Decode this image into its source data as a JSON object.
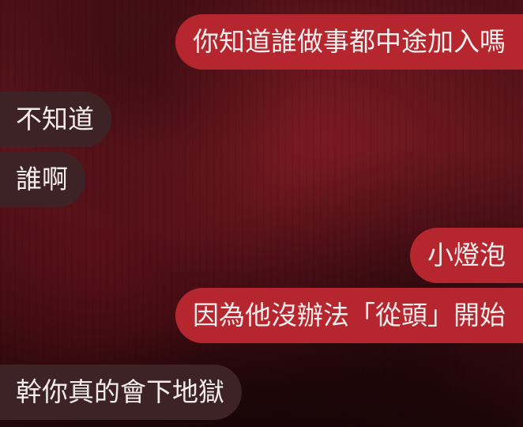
{
  "messages": [
    {
      "sender": "me",
      "text": "你知道誰做事都中途加入嗎"
    },
    {
      "sender": "other",
      "text": "不知道"
    },
    {
      "sender": "other",
      "text": "誰啊"
    },
    {
      "sender": "me",
      "text": "小燈泡"
    },
    {
      "sender": "me",
      "text": "因為他沒辦法「從頭」開始"
    },
    {
      "sender": "other",
      "text": "幹你真的會下地獄"
    }
  ],
  "colors": {
    "sent_bubble": "#b6262e",
    "received_bubble": "#3d2326",
    "text": "#f2ecec",
    "background": "#4a1016"
  }
}
